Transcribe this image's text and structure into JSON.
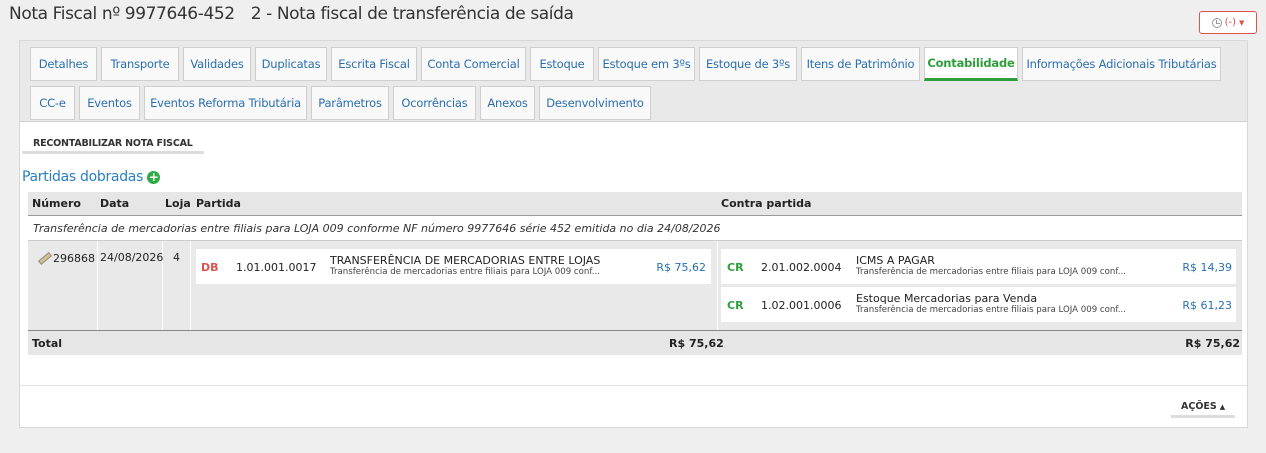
{
  "header": {
    "title": "Nota Fiscal nº 9977646-452",
    "subtitle": "2 - Nota fiscal de transferência de saída",
    "status_label": "(-)"
  },
  "tabs_row1": [
    "Detalhes",
    "Transporte",
    "Validades",
    "Duplicatas",
    "Escrita Fiscal",
    "Conta Comercial",
    "Estoque",
    "Estoque em 3ºs",
    "Estoque de 3ºs",
    "Itens de Patrimônio",
    "Contabilidade",
    "Informações Adicionais Tributárias"
  ],
  "tabs_row2": [
    "CC-e",
    "Eventos",
    "Eventos Reforma Tributária",
    "Parâmetros",
    "Ocorrências",
    "Anexos",
    "Desenvolvimento"
  ],
  "active_tab": "Contabilidade",
  "recontab_label": "RECONTABILIZAR NOTA FISCAL",
  "section_title": "Partidas dobradas",
  "table": {
    "headers": {
      "numero": "Número",
      "data": "Data",
      "loja": "Loja",
      "partida": "Partida",
      "contra": "Contra partida"
    },
    "description": "Transferência de mercadorias entre filiais para LOJA 009 conforme NF número 9977646 série 452 emitida no dia 24/08/2026",
    "row": {
      "numero": "296868",
      "data": "24/08/2026",
      "loja": "4",
      "debit": {
        "type": "DB",
        "account": "1.01.001.0017",
        "name": "TRANSFERÊNCIA DE MERCADORIAS ENTRE LOJAS",
        "desc": "Transferência de mercadorias entre filiais para LOJA 009 conf...",
        "value": "R$ 75,62"
      },
      "credits": [
        {
          "type": "CR",
          "account": "2.01.002.0004",
          "name": "ICMS A PAGAR",
          "desc": "Transferência de mercadorias entre filiais para LOJA 009 conf...",
          "value": "R$ 14,39"
        },
        {
          "type": "CR",
          "account": "1.02.001.0006",
          "name": "Estoque Mercadorias para Venda",
          "desc": "Transferência de mercadorias entre filiais para LOJA 009 conf...",
          "value": "R$ 61,23"
        }
      ]
    },
    "total": {
      "label": "Total",
      "debit": "R$ 75,62",
      "credit": "R$ 75,62"
    }
  },
  "actions_label": "AÇÕES",
  "colors": {
    "link": "#2a6fb0",
    "active": "#2e9e3a",
    "debit": "#d9534f",
    "credit": "#2e9e3a",
    "status": "#d9534f"
  }
}
